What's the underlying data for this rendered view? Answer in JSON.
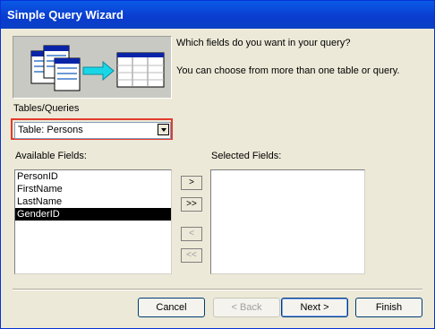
{
  "window": {
    "title": "Simple Query Wizard"
  },
  "prompt": {
    "line1": "Which fields do you want in your query?",
    "line2": "You can choose from more than one table or query."
  },
  "tables": {
    "label": "Tables/Queries",
    "selected": "Table: Persons"
  },
  "available": {
    "label": "Available Fields:",
    "items": [
      "PersonID",
      "FirstName",
      "LastName",
      "GenderID"
    ],
    "selected_index": 3
  },
  "selected_fields": {
    "label": "Selected Fields:",
    "items": []
  },
  "move_buttons": {
    "add_one": ">",
    "add_all": ">>",
    "remove_one": "<",
    "remove_all": "<<"
  },
  "buttons": {
    "cancel": "Cancel",
    "back": "< Back",
    "next": "Next >",
    "finish": "Finish"
  }
}
